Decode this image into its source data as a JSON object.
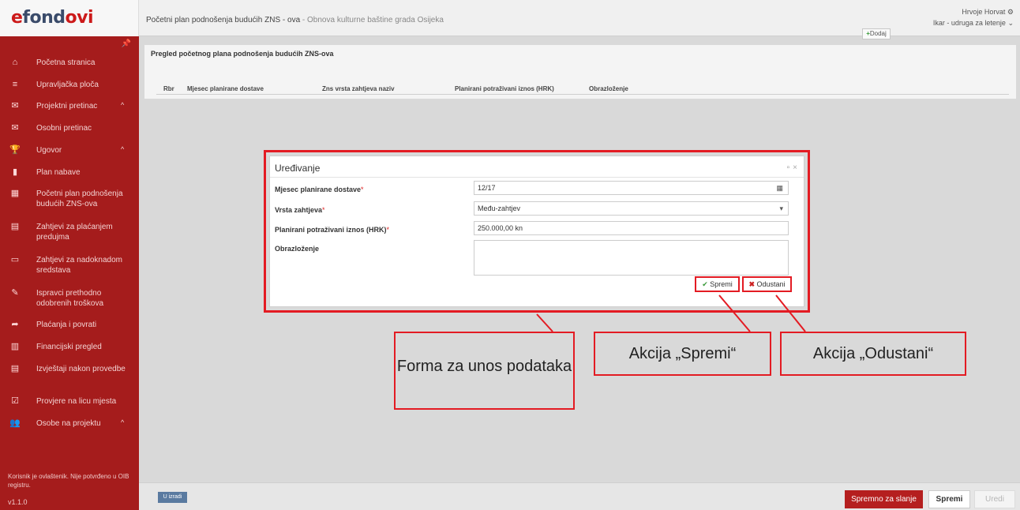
{
  "header": {
    "logo_e": "e",
    "logo_fond": "fond",
    "logo_ovi": "ovi",
    "title_main": "Početni plan podnošenja budućih ZNS - ova",
    "title_sep": " - ",
    "title_sub": "Obnova kulturne baštine grada Osijeka",
    "user_name": "Hrvoje Horvat",
    "user_org": "Ikar - udruga za letenje"
  },
  "sidebar": {
    "items": [
      {
        "label": "Početna stranica",
        "icon": "home-icon"
      },
      {
        "label": "Upravljačka ploča",
        "icon": "dashboard-icon"
      },
      {
        "label": "Projektni pretinac",
        "icon": "mail-icon",
        "caret": "^"
      },
      {
        "label": "Osobni pretinac",
        "icon": "mail-icon"
      },
      {
        "label": "Ugovor",
        "icon": "trophy-icon",
        "caret": "^"
      },
      {
        "label": "Plan nabave",
        "icon": "bookmark-icon"
      },
      {
        "label": "Početni plan podnošenja budućih ZNS-ova",
        "icon": "calendar-icon"
      },
      {
        "label": "Zahtjevi za plaćanjem predujma",
        "icon": "document-icon"
      },
      {
        "label": "Zahtjevi za nadoknadom sredstava",
        "icon": "card-icon"
      },
      {
        "label": "Ispravci prethodno odobrenih troškova",
        "icon": "edit-icon"
      },
      {
        "label": "Plaćanja i povrati",
        "icon": "share-icon"
      },
      {
        "label": "Financijski pregled",
        "icon": "chart-icon"
      },
      {
        "label": "Izvještaji nakon provedbe",
        "icon": "report-icon"
      },
      {
        "label": "Provjere na licu mjesta",
        "icon": "check-icon"
      },
      {
        "label": "Osobe na projektu",
        "icon": "users-icon",
        "caret": "^"
      }
    ],
    "note": "Korisnik je ovlaštenik. Nije potvrđeno u OIB registru.",
    "version": "v1.1.0"
  },
  "panel": {
    "title": "Pregled početnog plana podnošenja budućih ZNS-ova",
    "add_label": "Dodaj",
    "columns": [
      "Rbr",
      "Mjesec planirane dostave",
      "Zns vrsta zahtjeva naziv",
      "Planirani potraživani iznos (HRK)",
      "Obrazloženje"
    ]
  },
  "modal": {
    "title": "Uređivanje",
    "fields": [
      {
        "label": "Mjesec planirane dostave",
        "required": "*",
        "value": "12/17"
      },
      {
        "label": "Vrsta zahtjeva",
        "required": "*",
        "value": "Među-zahtjev"
      },
      {
        "label": "Planirani potraživani iznos (HRK)",
        "required": "*",
        "value": "250.000,00 kn"
      },
      {
        "label": "Obrazloženje",
        "required": "",
        "value": ""
      }
    ],
    "save_label": "Spremi",
    "cancel_label": "Odustani"
  },
  "footer": {
    "status_badge": "U izradi",
    "ready_label": "Spremno za slanje",
    "save_label": "Spremi",
    "edit_label": "Uredi"
  },
  "annotations": {
    "form": "Forma za unos podataka",
    "save": "Akcija „Spremi“",
    "cancel": "Akcija „Odustani“"
  },
  "colors": {
    "sidebar": "#a51c1c",
    "annotation": "#e31b23",
    "accent_green": "#3a9a3a"
  }
}
